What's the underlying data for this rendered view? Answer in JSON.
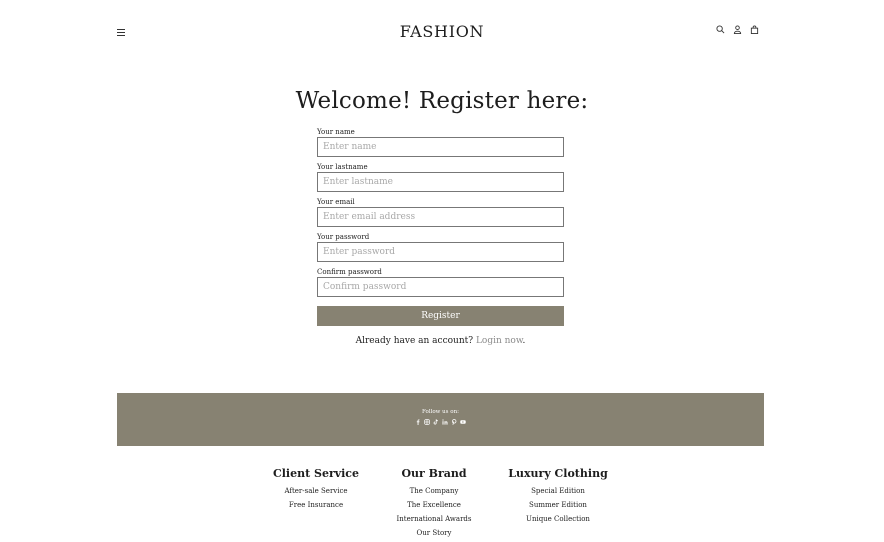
{
  "header": {
    "brand": "FASHION",
    "icons": [
      "search-icon",
      "user-icon",
      "bag-icon"
    ]
  },
  "page": {
    "title": "Welcome! Register here:"
  },
  "form": {
    "fields": [
      {
        "label": "Your name",
        "placeholder": "Enter name"
      },
      {
        "label": "Your lastname",
        "placeholder": "Enter lastname"
      },
      {
        "label": "Your email",
        "placeholder": "Enter email address"
      },
      {
        "label": "Your password",
        "placeholder": "Enter password"
      },
      {
        "label": "Confirm password",
        "placeholder": "Confirm password"
      }
    ],
    "submit_label": "Register",
    "login_prompt": "Already have an account?",
    "login_link": "Login now",
    "login_suffix": "."
  },
  "follow": {
    "label": "Follow us on:",
    "icons": [
      "facebook-icon",
      "instagram-icon",
      "tiktok-icon",
      "linkedin-icon",
      "pinterest-icon",
      "youtube-icon"
    ]
  },
  "footer": {
    "columns": [
      {
        "title": "Client Service",
        "links": [
          "After-sale Service",
          "Free Insurance"
        ]
      },
      {
        "title": "Our Brand",
        "links": [
          "The Company",
          "The Excellence",
          "International Awards",
          "Our Story"
        ]
      },
      {
        "title": "Luxury Clothing",
        "links": [
          "Special Edition",
          "Summer Edition",
          "Unique Collection"
        ]
      }
    ]
  },
  "colors": {
    "accent": "#878272",
    "link_muted": "#8c8c8c"
  }
}
